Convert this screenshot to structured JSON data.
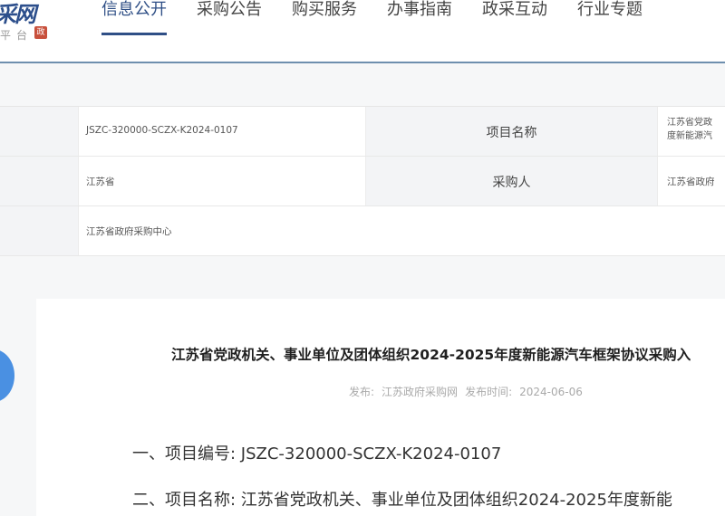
{
  "header": {
    "logo_text": "采网",
    "logo_sub": "平台",
    "logo_seal": "政",
    "nav": [
      {
        "label": "信息公开",
        "active": true
      },
      {
        "label": "采购公告"
      },
      {
        "label": "购买服务"
      },
      {
        "label": "办事指南"
      },
      {
        "label": "政采互动"
      },
      {
        "label": "行业专题"
      }
    ]
  },
  "info_table": {
    "rows": [
      {
        "value": "JSZC-320000-SCZX-K2024-0107",
        "label": "项目名称",
        "right_value_1": "江苏省党政",
        "right_value_2": "度新能源汽"
      },
      {
        "value": "江苏省",
        "label": "采购人",
        "right_value_1": "江苏省政府"
      },
      {
        "value": "江苏省政府采购中心"
      }
    ]
  },
  "article": {
    "title": "江苏省党政机关、事业单位及团体组织2024-2025年度新能源汽车框架协议采购入",
    "meta_publish_label": "发布:",
    "meta_source": "江苏政府采购网",
    "meta_time_label": "发布时间:",
    "meta_time": "2024-06-06",
    "line1": "一、项目编号: JSZC-320000-SCZX-K2024-0107",
    "line2": "二、项目名称: 江苏省党政机关、事业单位及团体组织2024-2025年度新能"
  }
}
